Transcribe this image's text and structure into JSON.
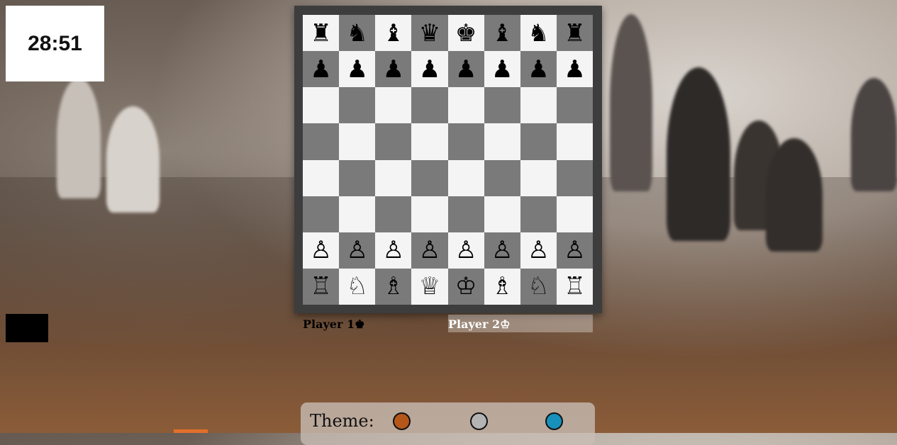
{
  "timer": {
    "text": "28:51"
  },
  "board": {
    "light_color": "#f4f4f4",
    "dark_color": "#7a7a7a",
    "frame_color": "#3d3d3d",
    "rows": [
      [
        "♜",
        "♞",
        "♝",
        "♛",
        "♚",
        "♝",
        "♞",
        "♜"
      ],
      [
        "♟",
        "♟",
        "♟",
        "♟",
        "♟",
        "♟",
        "♟",
        "♟"
      ],
      [
        "",
        "",
        "",
        "",
        "",
        "",
        "",
        ""
      ],
      [
        "",
        "",
        "",
        "",
        "",
        "",
        "",
        ""
      ],
      [
        "",
        "",
        "",
        "",
        "",
        "",
        "",
        ""
      ],
      [
        "",
        "",
        "",
        "",
        "",
        "",
        "",
        ""
      ],
      [
        "♙",
        "♙",
        "♙",
        "♙",
        "♙",
        "♙",
        "♙",
        "♙"
      ],
      [
        "♖",
        "♘",
        "♗",
        "♕",
        "♔",
        "♗",
        "♘",
        "♖"
      ]
    ]
  },
  "players": {
    "p1": "Player 1♚",
    "p2": "Player 2♔"
  },
  "theme": {
    "label": "Theme:",
    "options": [
      {
        "name": "brown",
        "color": "#b5561b"
      },
      {
        "name": "gray",
        "color": "#b4b4b4"
      },
      {
        "name": "blue",
        "color": "#1790bb"
      }
    ]
  }
}
